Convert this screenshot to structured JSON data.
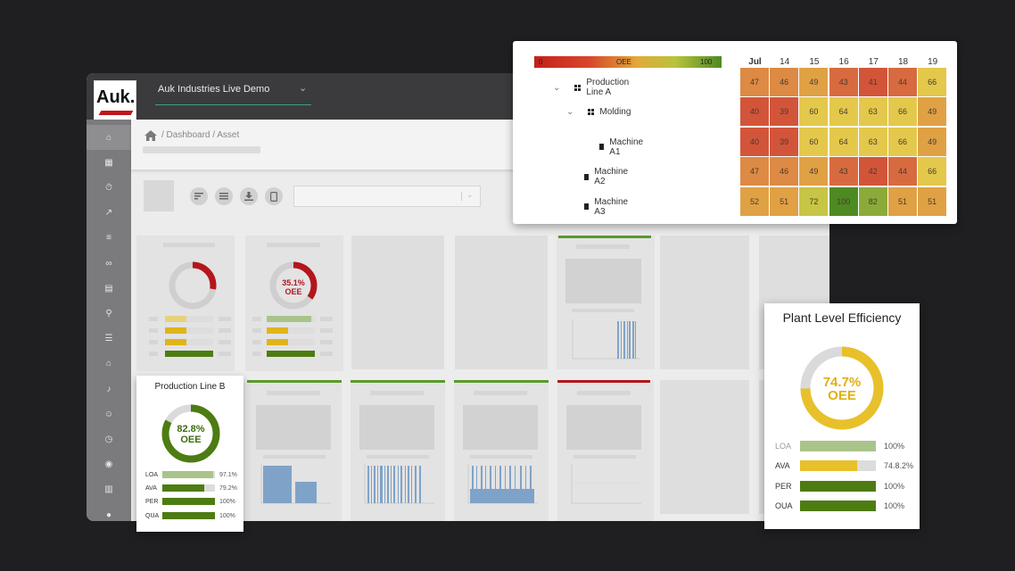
{
  "header": {
    "logo_text": "Auk.",
    "workspace": "Auk Industries Live Demo",
    "chevron": "⌄"
  },
  "breadcrumb": {
    "home_icon": "⌂",
    "text": "/ Dashboard / Asset"
  },
  "sidebar": {
    "icons": [
      "home-icon",
      "apps-icon",
      "timer-icon",
      "chart-icon",
      "sort-icon",
      "link-icon",
      "document-icon",
      "search-icon",
      "list-icon",
      "factory-icon",
      "bell-icon",
      "users-icon",
      "clock-icon",
      "broadcast-icon",
      "table-icon",
      "globe-icon"
    ]
  },
  "dashboard_tiles": {
    "tile2_oee": "35.1%",
    "tile2_label": "OEE"
  },
  "heatmap": {
    "legend_min": "0",
    "legend_label": "OEE",
    "legend_max": "100",
    "columns": [
      "Jul",
      "14",
      "15",
      "16",
      "17",
      "18",
      "19"
    ],
    "rows": [
      {
        "label": "Production Line A",
        "values": [
          "47",
          "46",
          "49",
          "43",
          "41",
          "44",
          "66"
        ]
      },
      {
        "label": "Molding",
        "values": [
          "40",
          "39",
          "60",
          "64",
          "63",
          "66",
          "49"
        ]
      },
      {
        "label": "Machine A1",
        "values": [
          "40",
          "39",
          "60",
          "64",
          "63",
          "66",
          "49"
        ]
      },
      {
        "label": "Machine A2",
        "values": [
          "47",
          "46",
          "49",
          "43",
          "42",
          "44",
          "66"
        ]
      },
      {
        "label": "Machine A3",
        "values": [
          "52",
          "51",
          "72",
          "100",
          "82",
          "51",
          "51"
        ]
      }
    ]
  },
  "plant_efficiency": {
    "title": "Plant Level Efficiency",
    "oee_value": "74.7%",
    "oee_label": "OEE",
    "oee_fraction": 0.747,
    "metrics": [
      {
        "label": "LOA",
        "value": "100%",
        "fill": 1.0,
        "color": "#a9c48a"
      },
      {
        "label": "AVA",
        "value": "74.8.2%",
        "fill": 0.748,
        "color": "#e8c02a"
      },
      {
        "label": "PER",
        "value": "100%",
        "fill": 1.0,
        "color": "#4d7c12"
      },
      {
        "label": "OUA",
        "value": "100%",
        "fill": 1.0,
        "color": "#4d7c12"
      }
    ]
  },
  "production_line_b": {
    "title": "Production Line B",
    "oee_value": "82.8%",
    "oee_label": "OEE",
    "oee_fraction": 0.828,
    "metrics": [
      {
        "label": "LOA",
        "value": "97.1%",
        "fill": 0.971,
        "color": "#a9c48a"
      },
      {
        "label": "AVA",
        "value": "79.2%",
        "fill": 0.792,
        "color": "#4d7c12"
      },
      {
        "label": "PER",
        "value": "100%",
        "fill": 1.0,
        "color": "#4d7c12"
      },
      {
        "label": "QUA",
        "value": "100%",
        "fill": 1.0,
        "color": "#4d7c12"
      }
    ]
  },
  "colors": {
    "good": "#4d7c12",
    "warn": "#e8c02a",
    "bad": "#b3161c"
  }
}
